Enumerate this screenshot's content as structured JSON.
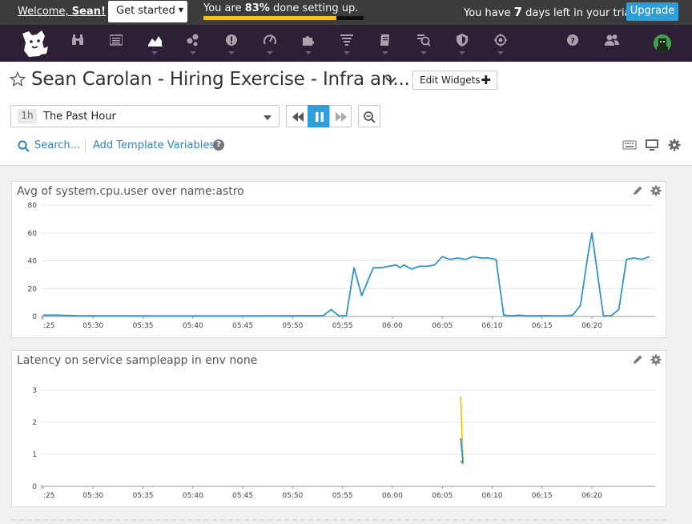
{
  "promo": {
    "welcome_prefix": "Welcome,",
    "welcome_name": "Sean!",
    "get_started": "Get started",
    "progress_prefix": "You are",
    "progress_pct": "83%",
    "progress_suffix": "done setting up.",
    "progress_value": 0.83,
    "trial_prefix": "You have",
    "trial_days": "7",
    "trial_suffix": "days left in your trial.",
    "upgrade": "Upgrade"
  },
  "nav": {
    "items": [
      {
        "icon": "binoculars-icon",
        "dropdown": false
      },
      {
        "icon": "list-icon",
        "dropdown": false
      },
      {
        "icon": "dashboards-icon",
        "dropdown": true,
        "active": true
      },
      {
        "icon": "infrastructure-icon",
        "dropdown": true
      },
      {
        "icon": "monitors-icon",
        "dropdown": true
      },
      {
        "icon": "apm-gauge-icon",
        "dropdown": true
      },
      {
        "icon": "integrations-puzzle-icon",
        "dropdown": true
      },
      {
        "icon": "logs-icon",
        "dropdown": true
      },
      {
        "icon": "notebook-icon",
        "dropdown": true
      },
      {
        "icon": "synthetics-icon",
        "dropdown": true
      },
      {
        "icon": "security-shield-icon",
        "dropdown": true
      },
      {
        "icon": "rum-icon",
        "dropdown": true
      }
    ],
    "right": [
      "help-icon",
      "team-icon",
      "avatar"
    ]
  },
  "header": {
    "title": "Sean Carolan - Hiring Exercise - Infra an...",
    "edit_widgets": "Edit Widgets",
    "time_badge": "1h",
    "time_label": "The Past Hour",
    "search": "Search...",
    "add_template": "Add Template Variables"
  },
  "widgets": [
    {
      "title": "Avg of system.cpu.user over name:astro",
      "chart_data": {
        "type": "line",
        "yticks": [
          0,
          20,
          40,
          60,
          80
        ],
        "ylim": [
          0,
          80
        ],
        "xlim": [
          0,
          60
        ],
        "xticks": [
          ":25",
          "05:30",
          "05:35",
          "05:40",
          "05:45",
          "05:50",
          "05:55",
          "06:00",
          "06:05",
          "06:10",
          "06:15",
          "06:20"
        ],
        "series": [
          {
            "color": "#2f94c9",
            "x": [
              0,
              1.5,
              3,
              5,
              10,
              15,
              20,
              25,
              30,
              35,
              36.5,
              37.5,
              38.5,
              39.5,
              40.5,
              41.5,
              43,
              44,
              45,
              46,
              46.5,
              47,
              48,
              49,
              50,
              51,
              52,
              53,
              54,
              55,
              56,
              57,
              58,
              59,
              60,
              61,
              62,
              63,
              64,
              65,
              66,
              67,
              68,
              69,
              70,
              71,
              71.5,
              72,
              72.5,
              73,
              74,
              75,
              76,
              77,
              78,
              79
            ],
            "y": [
              1,
              1,
              0.8,
              0.5,
              0.5,
              0.4,
              0.4,
              0.4,
              0.5,
              0.6,
              0.6,
              5,
              0.6,
              0.6,
              35,
              15,
              35,
              35,
              36,
              37,
              35,
              37,
              34,
              36,
              36,
              37,
              43,
              41,
              42,
              41,
              43,
              42,
              42,
              41,
              1,
              0.5,
              1,
              0.5,
              0.5,
              0.6,
              0.6,
              0.5,
              0.5,
              1,
              8,
              45,
              60,
              40,
              20,
              0.5,
              0.5,
              5,
              41,
              42,
              41,
              43
            ]
          }
        ]
      }
    },
    {
      "title": "Latency on service sampleapp in env none",
      "chart_data": {
        "type": "line",
        "yticks": [
          0,
          1,
          2,
          3
        ],
        "ylim": [
          0,
          3.5
        ],
        "xlim": [
          0,
          60
        ],
        "xticks": [
          ":25",
          "05:30",
          "05:35",
          "05:40",
          "05:45",
          "05:50",
          "05:55",
          "06:00",
          "06:05",
          "06:10",
          "06:15",
          "06:20"
        ],
        "series": [
          {
            "color": "#f2c318",
            "x": [
              54.4,
              54.7
            ],
            "y": [
              2.8,
              0.7
            ]
          },
          {
            "color": "#2f94c9",
            "x": [
              54.4,
              54.7
            ],
            "y": [
              1.5,
              0.75
            ]
          },
          {
            "color": "#6ba34a",
            "x": [
              54.4,
              54.7
            ],
            "y": [
              0.8,
              0.7
            ]
          }
        ]
      }
    }
  ]
}
